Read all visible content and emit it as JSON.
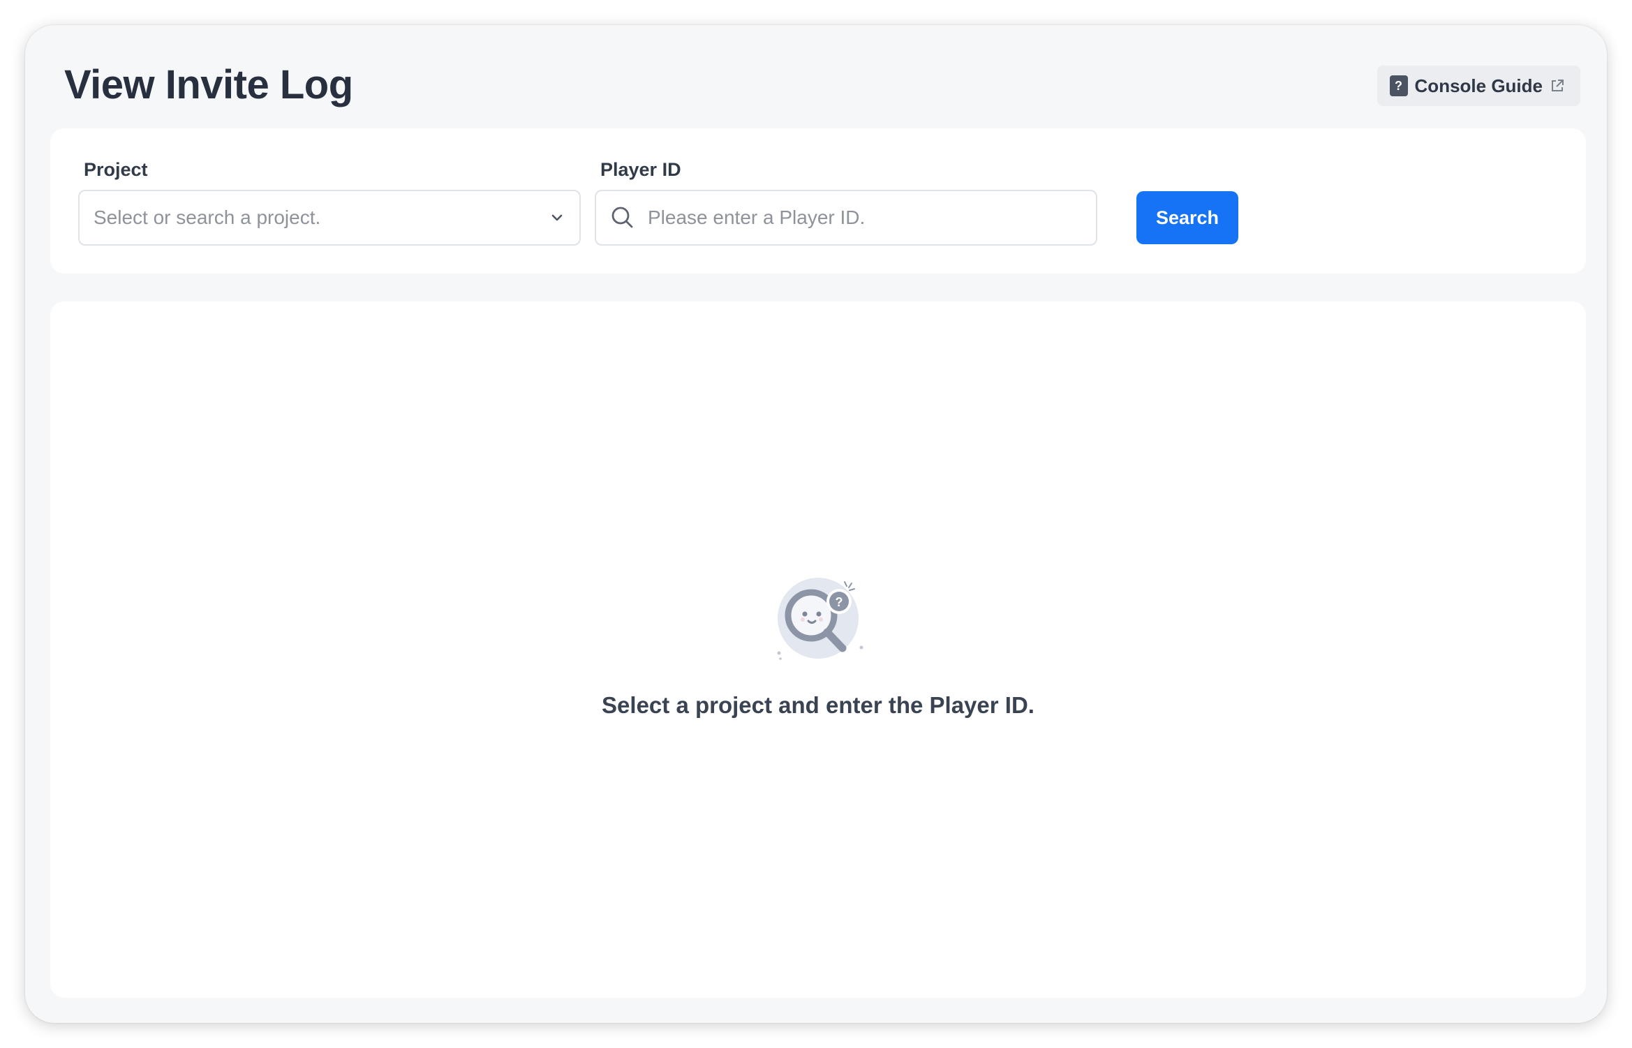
{
  "page": {
    "title": "View Invite Log",
    "guide_button": {
      "label": "Console Guide",
      "doc_glyph": "?",
      "icons": [
        "doc-help-icon",
        "external-link-icon"
      ]
    }
  },
  "filters": {
    "project": {
      "label": "Project",
      "placeholder": "Select or search a project.",
      "value": ""
    },
    "player_id": {
      "label": "Player ID",
      "placeholder": "Please enter a Player ID.",
      "value": ""
    },
    "search_button": "Search"
  },
  "empty_state": {
    "message": "Select a project and enter the Player ID.",
    "illustration_glyph": "?",
    "icon": "magnifier-question-icon"
  },
  "colors": {
    "accent": "#1673f5",
    "window_bg": "#f6f7f9",
    "card_bg": "#ffffff",
    "text_primary": "#283040"
  }
}
